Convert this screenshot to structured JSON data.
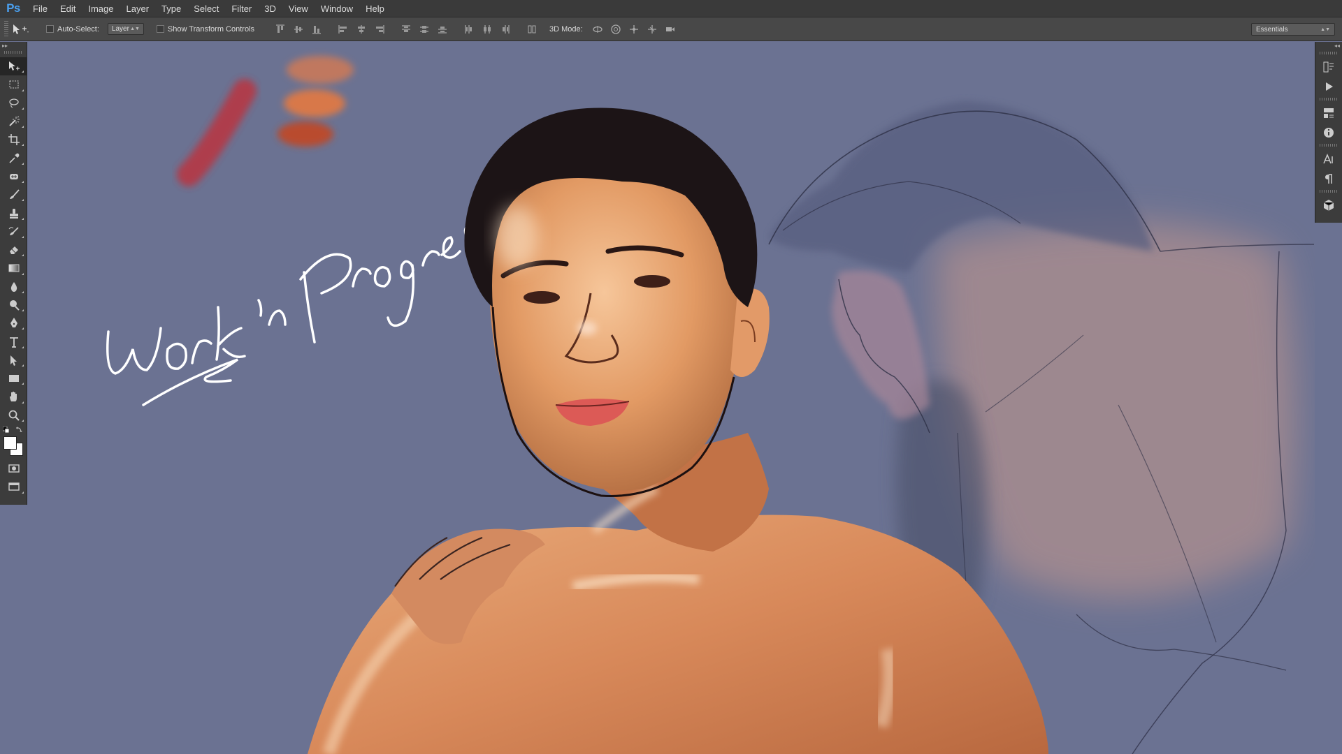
{
  "app": {
    "logo": "Ps"
  },
  "menu": [
    "File",
    "Edit",
    "Image",
    "Layer",
    "Type",
    "Select",
    "Filter",
    "3D",
    "View",
    "Window",
    "Help"
  ],
  "options": {
    "auto_select_label": "Auto-Select:",
    "auto_select_checked": false,
    "target_value": "Layer",
    "transform_controls_label": "Show Transform Controls",
    "transform_controls_checked": false,
    "mode_label": "3D Mode:",
    "workspace_value": "Essentials",
    "align_icons": [
      "align-top-edges-icon",
      "align-vertical-centers-icon",
      "align-bottom-edges-icon",
      "align-left-edges-icon",
      "align-horizontal-centers-icon",
      "align-right-edges-icon",
      "distribute-top-icon",
      "distribute-vertical-centers-icon",
      "distribute-bottom-icon",
      "distribute-left-icon",
      "distribute-horizontal-centers-icon",
      "distribute-right-icon",
      "auto-align-layers-icon"
    ],
    "mode_icons": [
      "rotate-3d-icon",
      "roll-3d-icon",
      "drag-3d-icon",
      "slide-3d-icon",
      "scale-3d-icon"
    ]
  },
  "tools": [
    "move-tool",
    "rectangular-marquee-tool",
    "lasso-tool",
    "magic-wand-tool",
    "crop-tool",
    "eyedropper-tool",
    "spot-healing-brush-tool",
    "brush-tool",
    "clone-stamp-tool",
    "history-brush-tool",
    "eraser-tool",
    "gradient-tool",
    "blur-tool",
    "dodge-tool",
    "pen-tool",
    "type-tool",
    "path-selection-tool",
    "rectangle-tool",
    "hand-tool",
    "zoom-tool"
  ],
  "colors": {
    "foreground": "#ffffff",
    "background": "#ffffff",
    "canvas": "#6b7292",
    "accent": "#4aa0f0"
  },
  "right_dock_icons": [
    "history-panel-icon",
    "actions-panel-icon",
    "properties-panel-icon",
    "info-panel-icon",
    "character-panel-icon",
    "paragraph-panel-icon",
    "3d-panel-icon"
  ],
  "artwork": {
    "handwritten_text": "Work in Progress"
  }
}
